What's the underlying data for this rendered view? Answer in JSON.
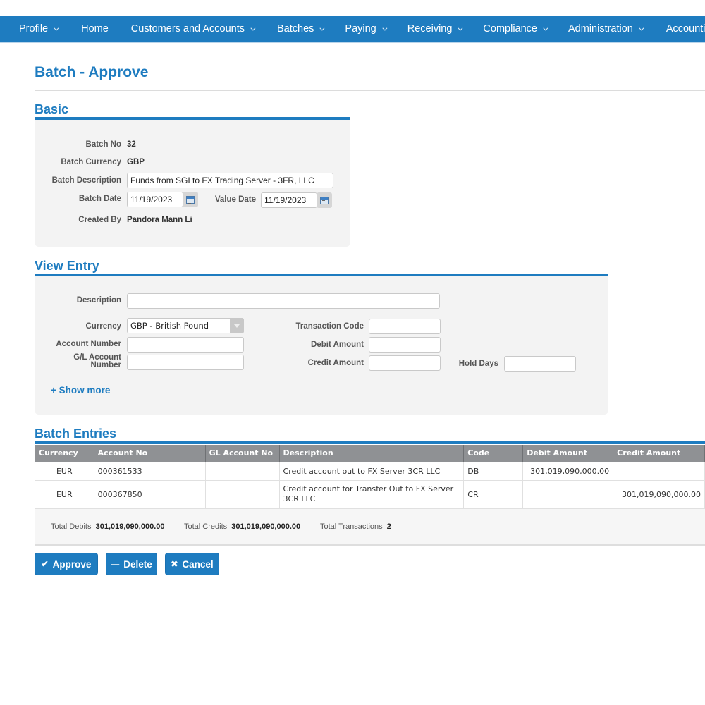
{
  "nav": {
    "items": [
      {
        "label": "Profile",
        "dropdown": true
      },
      {
        "label": "Home",
        "dropdown": false
      },
      {
        "label": "Customers and Accounts",
        "dropdown": true
      },
      {
        "label": "Batches",
        "dropdown": true
      },
      {
        "label": "Paying",
        "dropdown": true
      },
      {
        "label": "Receiving",
        "dropdown": true
      },
      {
        "label": "Compliance",
        "dropdown": true
      },
      {
        "label": "Administration",
        "dropdown": true
      },
      {
        "label": "Accounting",
        "dropdown": false
      }
    ]
  },
  "page": {
    "title": "Batch - Approve"
  },
  "basic": {
    "title": "Basic",
    "batch_no_label": "Batch No",
    "batch_no": "32",
    "batch_currency_label": "Batch Currency",
    "batch_currency": "GBP",
    "batch_description_label": "Batch Description",
    "batch_description": "Funds from SGI to FX Trading Server - 3FR, LLC",
    "batch_date_label": "Batch Date",
    "batch_date": "11/19/2023",
    "value_date_label": "Value Date",
    "value_date": "11/19/2023",
    "created_by_label": "Created By",
    "created_by": "Pandora Mann Li"
  },
  "view_entry": {
    "title": "View Entry",
    "description_label": "Description",
    "description": "",
    "currency_label": "Currency",
    "currency": "GBP - British Pound",
    "account_number_label": "Account Number",
    "account_number": "",
    "gl_account_label_1": "G/L Account",
    "gl_account_label_2": "Number",
    "gl_account": "",
    "transaction_code_label": "Transaction Code",
    "transaction_code": "",
    "debit_amount_label": "Debit Amount",
    "debit_amount": "",
    "credit_amount_label": "Credit Amount",
    "credit_amount": "",
    "hold_days_label": "Hold Days",
    "hold_days": "",
    "show_more": "+ Show more"
  },
  "entries": {
    "title": "Batch Entries",
    "columns": [
      "Currency",
      "Account No",
      "GL Account No",
      "Description",
      "Code",
      "Debit Amount",
      "Credit Amount"
    ],
    "rows": [
      {
        "currency": "EUR",
        "account_no": "000361533",
        "gl_account_no": "",
        "description": "Credit account out to FX Server 3CR LLC",
        "code": "DB",
        "debit": "301,019,090,000.00",
        "credit": ""
      },
      {
        "currency": "EUR",
        "account_no": "000367850",
        "gl_account_no": "",
        "description": "Credit account for Transfer Out to FX Server 3CR LLC",
        "code": "CR",
        "debit": "",
        "credit": "301,019,090,000.00"
      }
    ]
  },
  "totals": {
    "debits_label": "Total Debits",
    "debits": "301,019,090,000.00",
    "credits_label": "Total Credits",
    "credits": "301,019,090,000.00",
    "transactions_label": "Total Transactions",
    "transactions": "2"
  },
  "actions": {
    "approve": "Approve",
    "delete": "Delete",
    "cancel": "Cancel"
  },
  "colors": {
    "accent": "#1e7cc0",
    "table_header": "#8f9194",
    "panel": "#f3f3f3"
  }
}
